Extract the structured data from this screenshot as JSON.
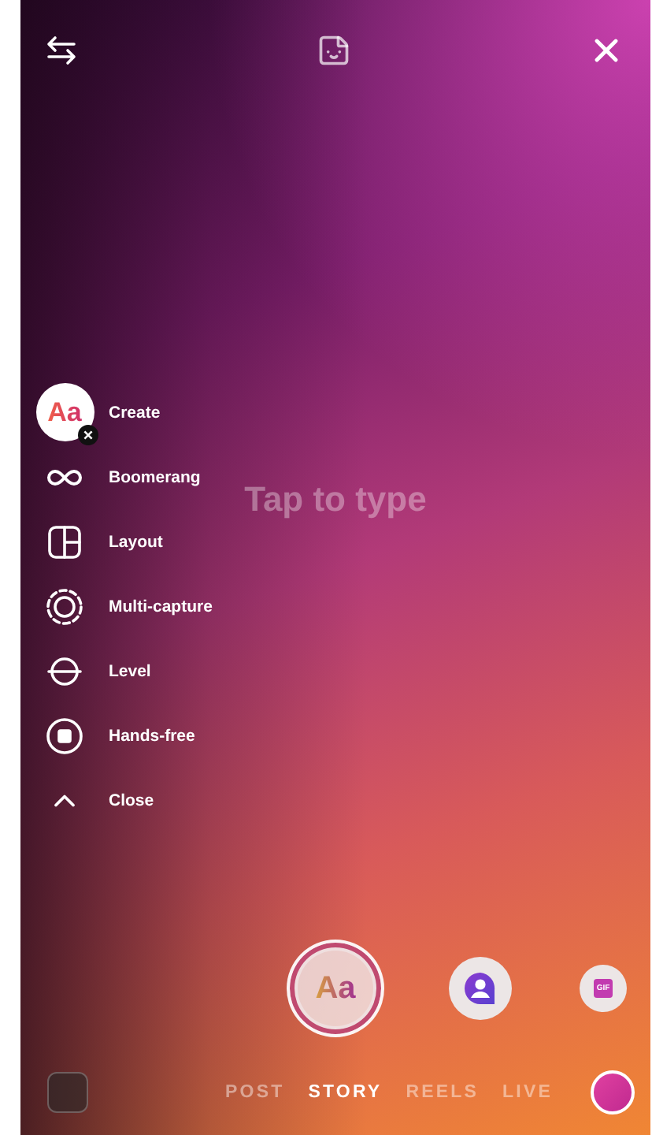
{
  "canvas": {
    "placeholder": "Tap to type"
  },
  "tools": [
    {
      "kind": "create",
      "label": "Create",
      "icon_text": "Aa"
    },
    {
      "kind": "boomerang",
      "label": "Boomerang"
    },
    {
      "kind": "layout",
      "label": "Layout"
    },
    {
      "kind": "multicapture",
      "label": "Multi-capture"
    },
    {
      "kind": "level",
      "label": "Level"
    },
    {
      "kind": "handsfree",
      "label": "Hands-free"
    },
    {
      "kind": "close",
      "label": "Close"
    }
  ],
  "capture": {
    "shutter_text": "Aa",
    "options": [
      {
        "kind": "avatar"
      },
      {
        "kind": "gif",
        "text": "GIF"
      }
    ]
  },
  "modes": [
    {
      "label": "POST",
      "selected": false
    },
    {
      "label": "STORY",
      "selected": true
    },
    {
      "label": "REELS",
      "selected": false
    },
    {
      "label": "LIVE",
      "selected": false
    }
  ]
}
